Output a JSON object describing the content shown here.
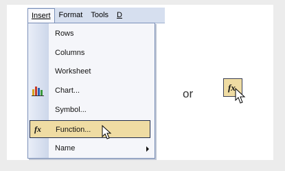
{
  "menubar": {
    "items": [
      {
        "label": "Insert",
        "active": true
      },
      {
        "label": "Format",
        "active": false
      },
      {
        "label": "Tools",
        "active": false
      },
      {
        "label": "D",
        "active": false
      }
    ]
  },
  "insert_menu": {
    "items": [
      {
        "label": "Rows",
        "icon": null
      },
      {
        "label": "Columns",
        "icon": null
      },
      {
        "label": "Worksheet",
        "icon": null
      },
      {
        "label": "Chart...",
        "icon": "chart-icon"
      },
      {
        "label": "Symbol...",
        "icon": null
      },
      {
        "label": "Function...",
        "icon": "fx-icon",
        "highlighted": true
      },
      {
        "label": "Name",
        "icon": null,
        "submenu": true
      }
    ]
  },
  "or_text": "or",
  "fx_button": {
    "label": "fx"
  },
  "colors": {
    "menubar_bg": "#d6dfef",
    "menu_bg": "#f5f6fa",
    "highlight_bg": "#efdca3",
    "border": "#7a8fb8"
  }
}
